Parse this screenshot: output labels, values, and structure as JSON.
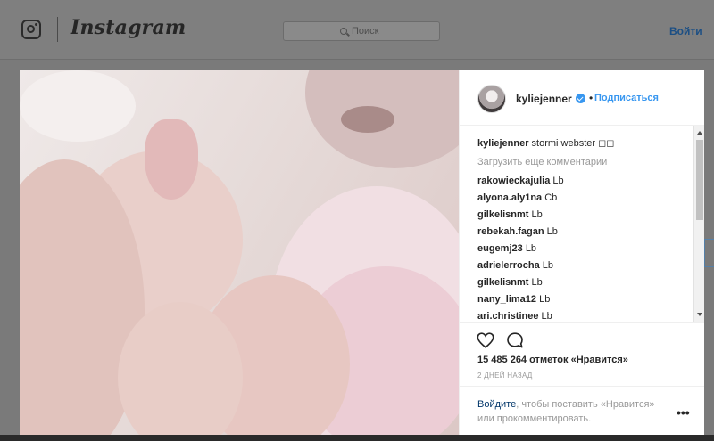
{
  "header": {
    "brand": "Instagram",
    "search_placeholder": "Поиск",
    "login_label": "Войти"
  },
  "post": {
    "username": "kyliejenner",
    "follow_label": "Подписаться",
    "caption_user": "kyliejenner",
    "caption_text": "stormi webster ◻◻",
    "load_more_label": "Загрузить еще комментарии",
    "comments": [
      {
        "user": "rakowieckajulia",
        "text": "Lb"
      },
      {
        "user": "alyona.aly1na",
        "text": "Cb"
      },
      {
        "user": "gilkelisnmt",
        "text": "Lb"
      },
      {
        "user": "rebekah.fagan",
        "text": "Lb"
      },
      {
        "user": "eugemj23",
        "text": "Lb"
      },
      {
        "user": "adrielerrocha",
        "text": "Lb"
      },
      {
        "user": "gilkelisnmt",
        "text": "Lb"
      },
      {
        "user": "nany_lima12",
        "text": "Lb"
      },
      {
        "user": "ari.christinee",
        "text": "Lb"
      }
    ],
    "likes_text": "15 485 264 отметок «Нравится»",
    "time_ago": "2 ДНЕЙ НАЗАД",
    "prompt_link": "Войдите",
    "prompt_rest": ", чтобы поставить «Нравится» или прокомментировать.",
    "more_glyph": "•••"
  },
  "icons": {
    "logo": "instagram-camera-icon",
    "search": "search-icon",
    "verified": "verified-badge-icon",
    "like": "heart-icon",
    "comment": "comment-bubble-icon",
    "more": "more-options-icon"
  },
  "colors": {
    "link_blue": "#3897f0",
    "dark_link": "#003569",
    "text": "#262626",
    "muted": "#999999"
  }
}
